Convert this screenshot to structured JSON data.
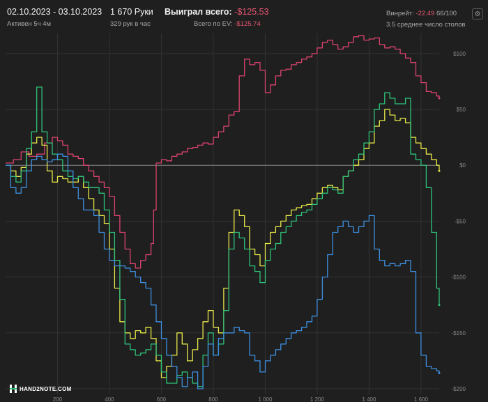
{
  "header": {
    "date_range": "02.10.2023 - 03.10.2023",
    "active": "Активен 5ч 4м",
    "hands": "1 670 Руки",
    "hands_per_hour": "329 рук в час",
    "won_label": "Выиграл всего:",
    "won_value": "-$125.53",
    "ev_label": "Всего по EV:",
    "ev_value": "-$125.74",
    "winrate_label": "Винрейт:",
    "winrate_value": "-22.49",
    "winrate_suffix": "66/100",
    "avg_tables": "3.5 среднее число столов",
    "settings_icon": "gear-icon"
  },
  "logo": {
    "text": "HAND2NOTE.COM",
    "icon": "hand2note-logo-icon"
  },
  "colors": {
    "background": "#1f1f1f",
    "grid": "#333333",
    "zero_line": "#8a8a8a",
    "pink": "#d9436e",
    "green": "#2ec27a",
    "yellow": "#e8e84a",
    "blue": "#3d8fe0"
  },
  "chart_data": {
    "type": "line",
    "y_ticks": [
      100,
      50,
      0,
      -50,
      -100,
      -150,
      -200
    ],
    "y_tick_labels": [
      "$100",
      "$50",
      "$0",
      "-$50",
      "-$100",
      "-$150",
      "-$200"
    ],
    "x_tick_labels": [
      "200",
      "400",
      "600",
      "800",
      "1 000",
      "1 200",
      "1 400",
      "1 600"
    ],
    "x_tick_values": [
      200,
      400,
      600,
      800,
      1000,
      1200,
      1400,
      1600
    ],
    "xlim": [
      0,
      1670
    ],
    "ylim": [
      -205,
      118
    ],
    "grid": true,
    "series": [
      {
        "color": "#d9436e",
        "x": [
          0,
          30,
          60,
          90,
          120,
          150,
          180,
          200,
          220,
          240,
          260,
          280,
          300,
          320,
          340,
          360,
          380,
          400,
          420,
          440,
          460,
          480,
          500,
          520,
          540,
          560,
          570,
          580,
          600,
          620,
          640,
          660,
          680,
          700,
          720,
          740,
          760,
          780,
          800,
          820,
          840,
          860,
          880,
          900,
          920,
          940,
          960,
          980,
          1000,
          1020,
          1040,
          1060,
          1080,
          1100,
          1120,
          1140,
          1160,
          1180,
          1200,
          1220,
          1240,
          1260,
          1280,
          1300,
          1320,
          1340,
          1360,
          1380,
          1400,
          1420,
          1440,
          1460,
          1480,
          1500,
          1520,
          1540,
          1560,
          1580,
          1600,
          1620,
          1640,
          1660,
          1670
        ],
        "y": [
          2,
          5,
          12,
          8,
          10,
          20,
          25,
          22,
          18,
          10,
          8,
          6,
          0,
          -5,
          -10,
          -15,
          -20,
          -28,
          -45,
          -60,
          -75,
          -88,
          -92,
          -85,
          -80,
          -70,
          -40,
          2,
          5,
          4,
          8,
          10,
          12,
          15,
          16,
          18,
          20,
          19,
          25,
          30,
          35,
          45,
          48,
          80,
          95,
          90,
          92,
          85,
          65,
          72,
          80,
          85,
          86,
          90,
          92,
          95,
          97,
          100,
          105,
          110,
          112,
          108,
          104,
          106,
          110,
          115,
          116,
          112,
          113,
          114,
          108,
          105,
          106,
          104,
          100,
          96,
          92,
          80,
          74,
          66,
          65,
          62,
          60
        ]
      },
      {
        "color": "#e8e84a",
        "x": [
          0,
          20,
          40,
          60,
          80,
          100,
          120,
          140,
          160,
          180,
          200,
          220,
          240,
          260,
          280,
          300,
          320,
          340,
          360,
          380,
          400,
          420,
          440,
          460,
          480,
          500,
          520,
          540,
          560,
          580,
          600,
          620,
          640,
          660,
          680,
          700,
          720,
          740,
          760,
          780,
          800,
          820,
          840,
          860,
          880,
          900,
          920,
          940,
          960,
          980,
          1000,
          1020,
          1040,
          1060,
          1080,
          1100,
          1120,
          1140,
          1160,
          1180,
          1200,
          1220,
          1240,
          1260,
          1280,
          1300,
          1320,
          1340,
          1360,
          1380,
          1400,
          1420,
          1440,
          1460,
          1480,
          1500,
          1520,
          1540,
          1560,
          1580,
          1600,
          1620,
          1640,
          1660,
          1670
        ],
        "y": [
          0,
          -5,
          -10,
          -2,
          10,
          20,
          25,
          18,
          -5,
          -15,
          -10,
          -12,
          -15,
          -15,
          -10,
          -20,
          -30,
          -40,
          -45,
          -52,
          -75,
          -110,
          -140,
          -150,
          -155,
          -148,
          -150,
          -145,
          -155,
          -175,
          -190,
          -180,
          -170,
          -150,
          -160,
          -175,
          -165,
          -155,
          -140,
          -130,
          -145,
          -150,
          -110,
          -60,
          -40,
          -45,
          -55,
          -75,
          -80,
          -90,
          -70,
          -60,
          -55,
          -50,
          -45,
          -40,
          -38,
          -36,
          -35,
          -30,
          -25,
          -20,
          -18,
          -20,
          -22,
          -10,
          -5,
          0,
          5,
          15,
          20,
          35,
          40,
          50,
          45,
          40,
          42,
          38,
          25,
          20,
          15,
          10,
          5,
          0,
          -5
        ]
      },
      {
        "color": "#2ec27a",
        "x": [
          0,
          20,
          40,
          60,
          80,
          100,
          120,
          140,
          160,
          180,
          200,
          220,
          240,
          260,
          280,
          300,
          320,
          340,
          360,
          380,
          400,
          420,
          440,
          460,
          480,
          500,
          520,
          540,
          560,
          580,
          600,
          620,
          640,
          660,
          680,
          700,
          720,
          740,
          760,
          780,
          800,
          820,
          840,
          860,
          880,
          900,
          920,
          940,
          960,
          980,
          1000,
          1020,
          1040,
          1060,
          1080,
          1100,
          1120,
          1140,
          1160,
          1180,
          1200,
          1220,
          1240,
          1260,
          1280,
          1300,
          1320,
          1340,
          1360,
          1380,
          1400,
          1420,
          1440,
          1460,
          1480,
          1500,
          1520,
          1540,
          1560,
          1580,
          1600,
          1620,
          1640,
          1660,
          1670
        ],
        "y": [
          0,
          -10,
          -15,
          -5,
          15,
          30,
          70,
          30,
          20,
          10,
          5,
          -5,
          -10,
          -12,
          -10,
          -15,
          -20,
          -20,
          -25,
          -40,
          -60,
          -85,
          -120,
          -160,
          -165,
          -170,
          -168,
          -165,
          -160,
          -170,
          -185,
          -195,
          -195,
          -188,
          -185,
          -190,
          -195,
          -198,
          -170,
          -150,
          -170,
          -160,
          -130,
          -75,
          -60,
          -65,
          -75,
          -90,
          -95,
          -105,
          -85,
          -75,
          -70,
          -60,
          -55,
          -50,
          -45,
          -42,
          -40,
          -35,
          -30,
          -25,
          -20,
          -22,
          -25,
          -10,
          -5,
          5,
          10,
          20,
          30,
          50,
          55,
          65,
          60,
          55,
          55,
          60,
          10,
          5,
          0,
          -20,
          -60,
          -110,
          -125
        ]
      },
      {
        "color": "#3d8fe0",
        "x": [
          0,
          20,
          40,
          60,
          80,
          100,
          120,
          140,
          160,
          180,
          200,
          220,
          240,
          260,
          280,
          300,
          320,
          340,
          360,
          380,
          400,
          420,
          440,
          460,
          480,
          500,
          520,
          540,
          560,
          580,
          600,
          620,
          640,
          660,
          680,
          700,
          720,
          740,
          760,
          780,
          800,
          820,
          840,
          860,
          880,
          900,
          920,
          940,
          960,
          980,
          1000,
          1020,
          1040,
          1060,
          1080,
          1100,
          1120,
          1140,
          1160,
          1180,
          1200,
          1220,
          1240,
          1260,
          1280,
          1300,
          1320,
          1340,
          1360,
          1380,
          1400,
          1420,
          1440,
          1460,
          1480,
          1500,
          1520,
          1540,
          1560,
          1580,
          1600,
          1620,
          1640,
          1660,
          1670
        ],
        "y": [
          0,
          -20,
          -25,
          -20,
          -5,
          5,
          8,
          5,
          3,
          5,
          10,
          8,
          -5,
          -20,
          -30,
          -40,
          -40,
          -45,
          -60,
          -75,
          -85,
          -90,
          -90,
          -92,
          -95,
          -100,
          -105,
          -110,
          -125,
          -140,
          -155,
          -170,
          -180,
          -190,
          -198,
          -190,
          -185,
          -200,
          -180,
          -160,
          -170,
          -155,
          -150,
          -150,
          -145,
          -148,
          -150,
          -170,
          -175,
          -185,
          -175,
          -170,
          -165,
          -160,
          -155,
          -150,
          -148,
          -145,
          -140,
          -135,
          -120,
          -100,
          -80,
          -60,
          -55,
          -50,
          -55,
          -60,
          -55,
          -50,
          -45,
          -75,
          -85,
          -90,
          -88,
          -90,
          -88,
          -85,
          -95,
          -150,
          -170,
          -180,
          -182,
          -184,
          -186
        ]
      }
    ]
  }
}
